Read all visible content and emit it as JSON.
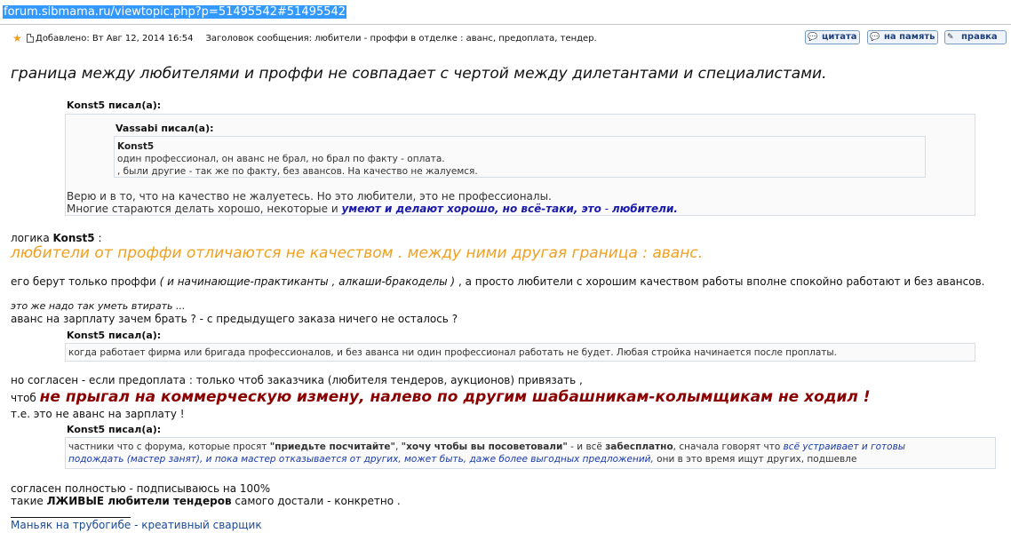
{
  "browser": {
    "url": "forum.sibmama.ru/viewtopic.php?p=51495542#51495542"
  },
  "post": {
    "added": "Добавлено: Вт Авг 12, 2014 16:54",
    "subject": "Заголовок сообщения: любители - проффи в отделке : аванс, предоплата, тендер.",
    "buttons": {
      "quote": "цитата",
      "memo": "на память",
      "edit": "правка"
    },
    "lead": "граница между любителями и проффи не совпадает с чертой между дилетантами и специалистами."
  },
  "quote1": {
    "author": "Konst5 писал(а):",
    "nested": {
      "author": "Vassabi писал(а):",
      "inner_name": "Konst5",
      "line1": "один профессионал, он аванс не брал, но брал по факту - оплата.",
      "line2": ", были другие - так же по факту, без авансов. На качество не жалуемся."
    },
    "line1": "Верю и в то, что на качество не жалуетесь. Но это любители, это не профессионалы.",
    "line2_plain": "Многие стараются делать хорошо, некоторые и ",
    "line2_bold1": "умеют и делают хорошо, но всё-таки, это",
    "line2_dash": " - ",
    "line2_bold2": "любители."
  },
  "body1": {
    "logic_prefix": "логика ",
    "logic_name": "Konst5",
    "logic_suffix": " :",
    "orange": "любители от проффи отличаются не качеством . между ними другая граница : аванс.",
    "line_a_1": "его берут только проффи ",
    "line_a_italic": "( и начинающие-практиканты , алкаши-бракоделы )",
    "line_a_2": " , а просто любители с хорошим качеством работы вполне спокойно работают и без авансов.",
    "line_b": "это же надо так уметь втирать ...",
    "line_c": "аванс на зарплату зачем брать ? - с предыдущего заказа ничего не осталось ?"
  },
  "quote2": {
    "author": "Konst5 писал(а):",
    "text": "когда работает фирма или бригада профессионалов, и без аванса ни один профессионал работать не будет. Любая стройка начинается после проплаты."
  },
  "body2": {
    "line1": "но согласен - если предоплата : только чтоб заказчика (любителя тендеров, аукционов) привязать ,",
    "line2_prefix": "чтоб ",
    "line2_red": "не прыгал на коммерческую измену, налево по другим шабашникам-колымщикам не ходил !",
    "line3": "т.е. это не аванс на зарплату !"
  },
  "quote3": {
    "author": "Konst5 писал(а):",
    "p1": "частники что с форума, которые просят ",
    "b1": "\"приедьте посчитайте\"",
    "p2": ", ",
    "b2": "\"хочу чтобы вы посоветовали\"",
    "p3": " - и всё ",
    "b3": "забесплатно",
    "p4": ", сначала говорят что ",
    "i1": "всё устраивает и готовы",
    "i2": "подождать (мастер занят), и пока мастер отказывается от других, может быть, даже более выгодных предложений,",
    "p5": " они в это время ищут других, подшевле"
  },
  "body3": {
    "line1": "согласен полностью - подписываюсь на 100%",
    "line2_prefix": "такие ",
    "line2_bold": "ЛЖИВЫЕ любители тендеров",
    "line2_suffix": " самого достали - конкретно ."
  },
  "signature": "Маньяк на трубогибе - креативный сварщик"
}
